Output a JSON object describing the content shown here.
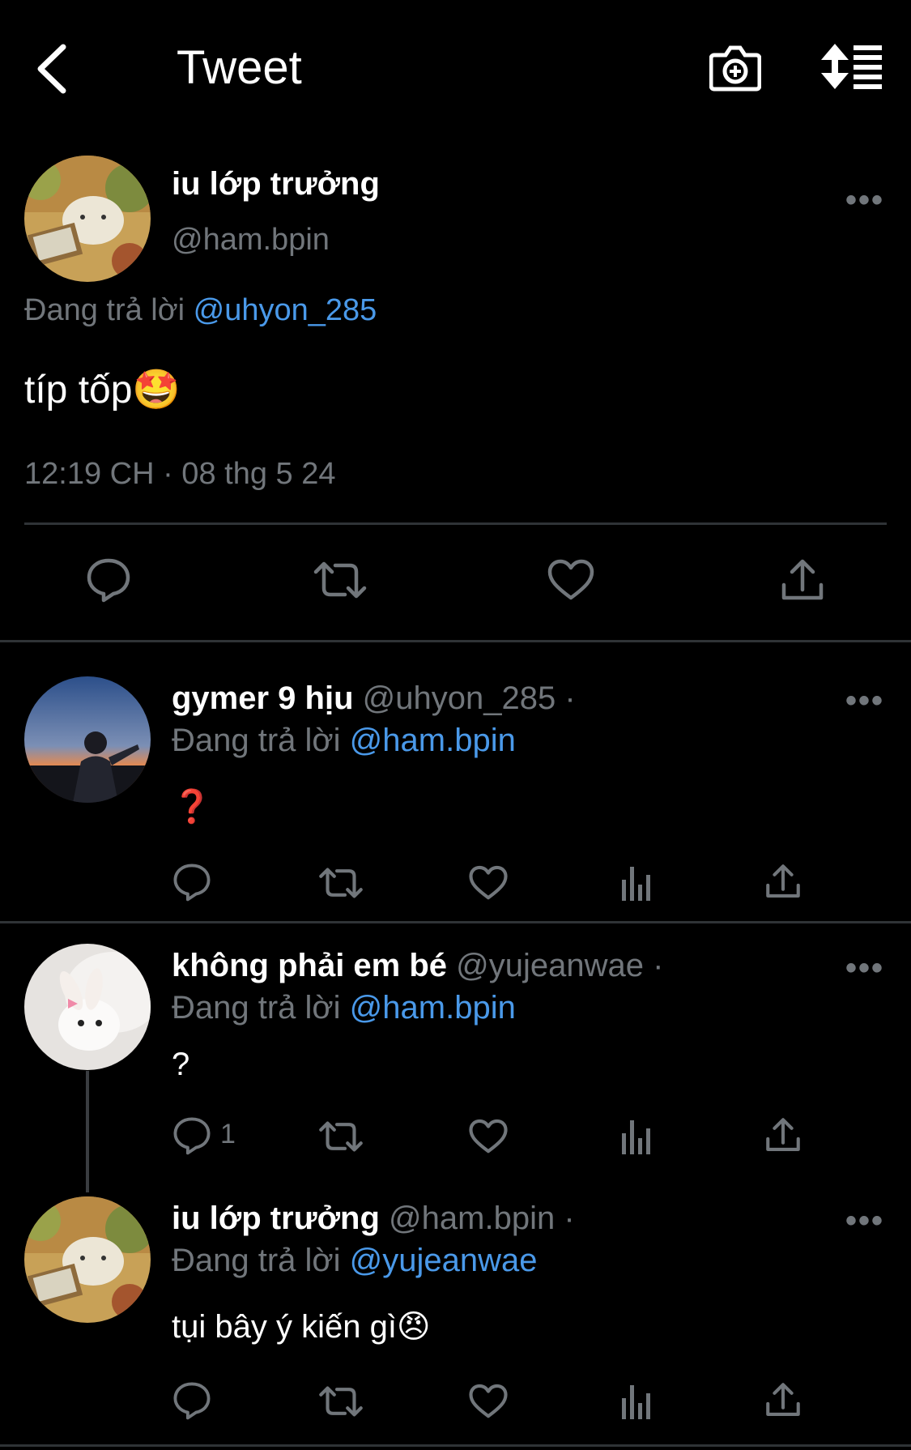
{
  "header": {
    "title": "Tweet",
    "back_icon": "chevron-left-icon",
    "camera_icon": "camera-plus-icon",
    "sort_icon": "sort-list-icon"
  },
  "colors": {
    "background": "#000000",
    "text": "#e7e9ea",
    "muted": "#71767b",
    "link": "#4a99e9",
    "divider": "#2f3336"
  },
  "main_tweet": {
    "name": "iu lớp trưởng",
    "handle": "@ham.bpin",
    "reply_prefix": "Đang trả lời",
    "reply_to": "@uhyon_285",
    "text": "típ tốp🤩",
    "timestamp": "12:19 CH · 08 thg 5 24",
    "more": "•••"
  },
  "replies": [
    {
      "name": "gymer 9 hịu",
      "handle": "@uhyon_285",
      "dot": "·",
      "reply_prefix": "Đang trả lời",
      "reply_to": "@ham.bpin",
      "text": "❓",
      "reply_count": "",
      "more": "•••"
    },
    {
      "name": "không phải em bé",
      "handle": "@yujeanwae",
      "dot": "·",
      "reply_prefix": "Đang trả lời",
      "reply_to": "@ham.bpin",
      "text": "?",
      "reply_count": "1",
      "more": "•••"
    },
    {
      "name": "iu lớp trưởng",
      "handle": "@ham.bpin",
      "dot": "·",
      "reply_prefix": "Đang trả lời",
      "reply_to": "@yujeanwae",
      "text": "tụi bây ý kiến gì😠",
      "reply_count": "",
      "more": "•••"
    }
  ]
}
